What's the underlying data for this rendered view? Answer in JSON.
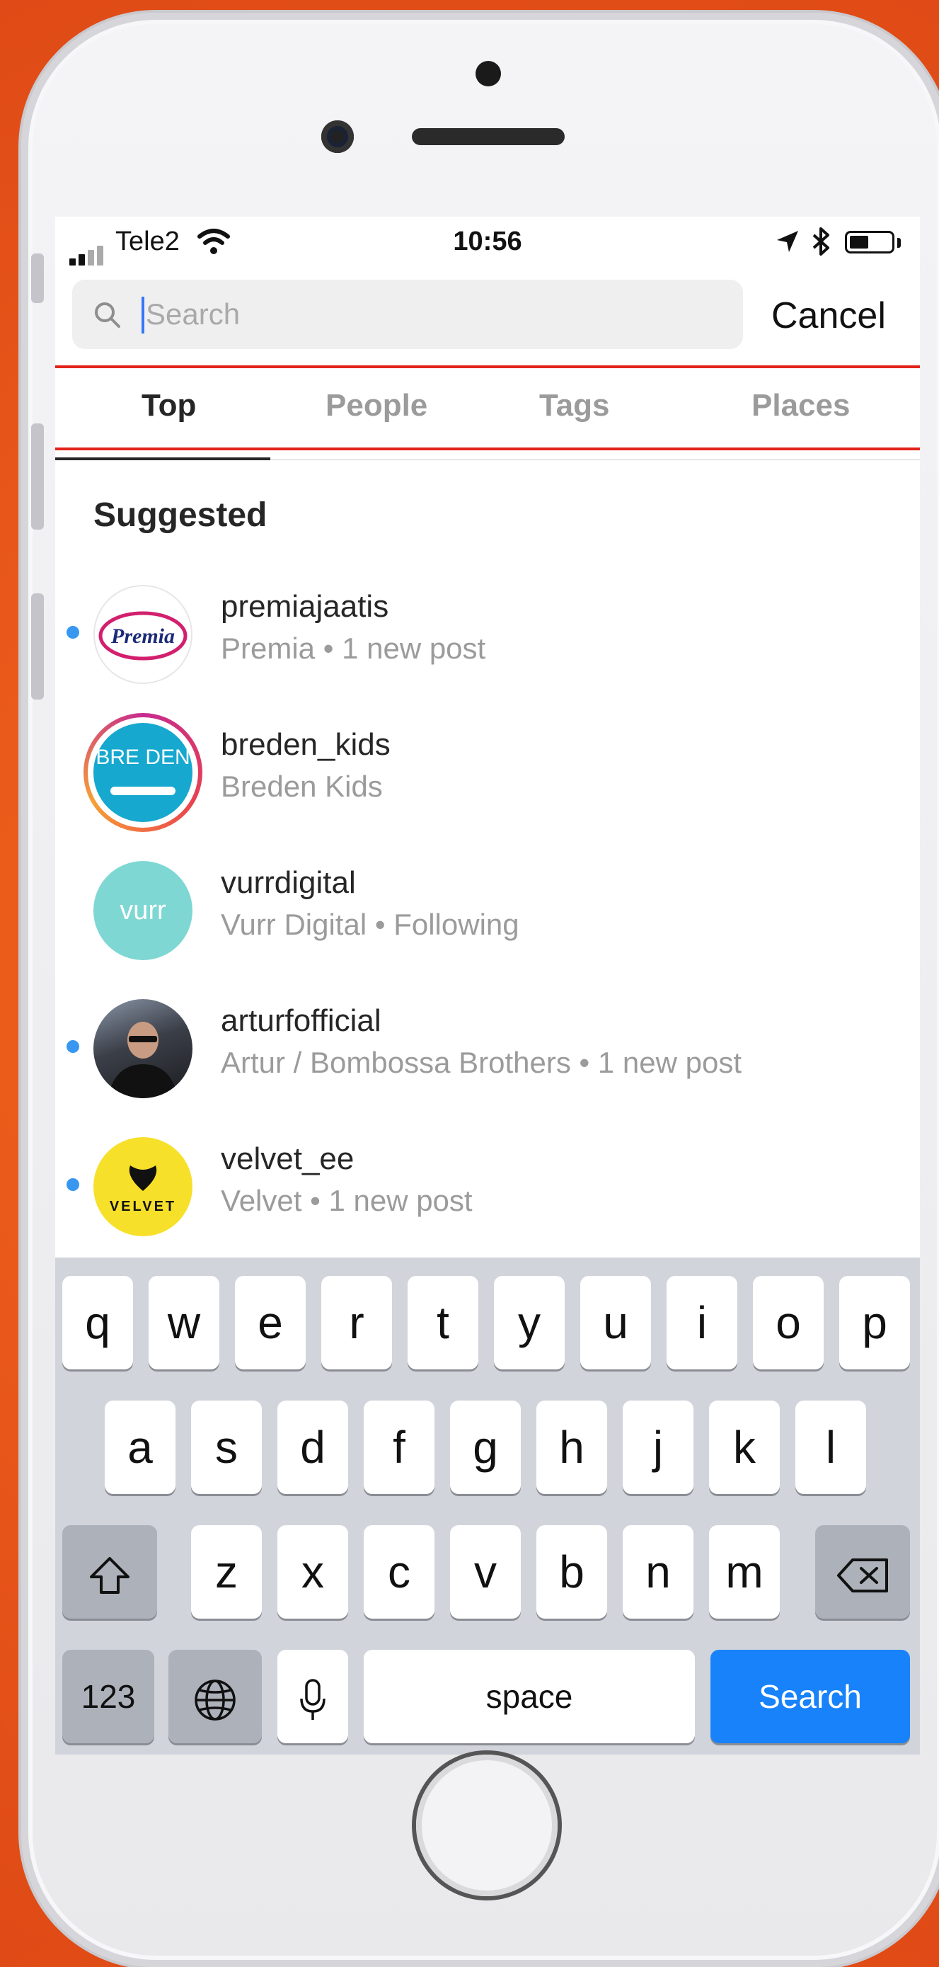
{
  "status_bar": {
    "carrier": "Tele2",
    "time": "10:56"
  },
  "search": {
    "placeholder": "Search",
    "value": "",
    "cancel_label": "Cancel"
  },
  "tabs": [
    {
      "label": "Top",
      "active": true
    },
    {
      "label": "People",
      "active": false
    },
    {
      "label": "Tags",
      "active": false
    },
    {
      "label": "Places",
      "active": false
    }
  ],
  "suggested": {
    "heading": "Suggested",
    "items": [
      {
        "username": "premiajaatis",
        "subtitle": "Premia • 1 new post",
        "unread": true,
        "avatar_text": "Premia"
      },
      {
        "username": "breden_kids",
        "subtitle": "Breden Kids",
        "unread": false,
        "avatar_text": "BRE DEN"
      },
      {
        "username": "vurrdigital",
        "subtitle": "Vurr Digital • Following",
        "unread": false,
        "avatar_text": "vurr"
      },
      {
        "username": "arturfofficial",
        "subtitle": "Artur / Bombossa Brothers • 1 new post",
        "unread": true,
        "avatar_text": ""
      },
      {
        "username": "velvet_ee",
        "subtitle": "Velvet • 1 new post",
        "unread": true,
        "avatar_text": "VELVET"
      }
    ]
  },
  "keyboard": {
    "row1": [
      "q",
      "w",
      "e",
      "r",
      "t",
      "y",
      "u",
      "i",
      "o",
      "p"
    ],
    "row2": [
      "a",
      "s",
      "d",
      "f",
      "g",
      "h",
      "j",
      "k",
      "l"
    ],
    "row3": [
      "z",
      "x",
      "c",
      "v",
      "b",
      "n",
      "m"
    ],
    "numbers_label": "123",
    "space_label": "space",
    "search_label": "Search"
  },
  "colors": {
    "accent_blue": "#3897f0",
    "keyboard_search_blue": "#1882fb",
    "highlight_red": "#e2231a"
  }
}
